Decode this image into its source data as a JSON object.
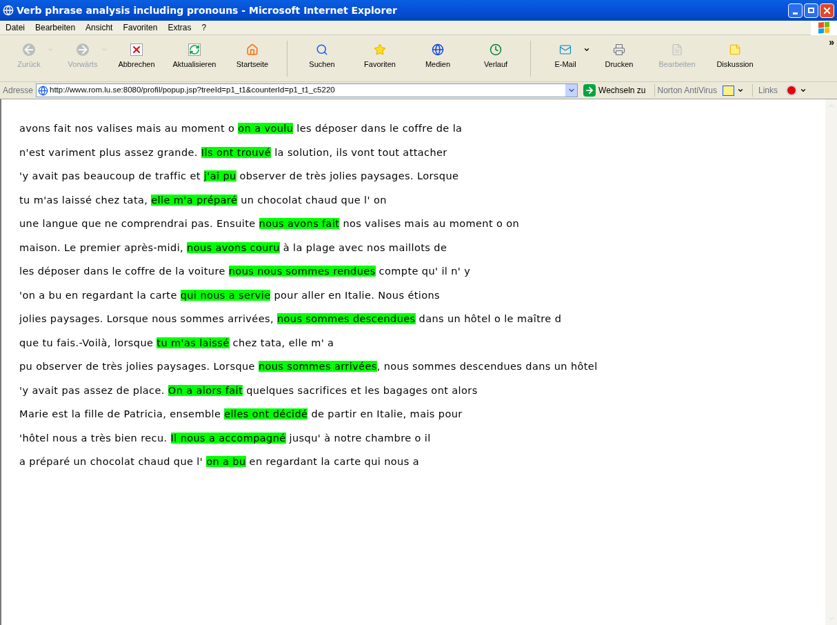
{
  "window": {
    "title": "Verb phrase analysis including pronouns - Microsoft Internet Explorer"
  },
  "menu": [
    "Datei",
    "Bearbeiten",
    "Ansicht",
    "Favoriten",
    "Extras",
    "?"
  ],
  "toolbar": [
    {
      "kind": "back",
      "label": "Zurück",
      "disabled": true,
      "dropdown": true
    },
    {
      "kind": "forward",
      "label": "Vorwärts",
      "disabled": true,
      "dropdown": true
    },
    {
      "kind": "stop",
      "label": "Abbrechen",
      "disabled": false,
      "dropdown": false
    },
    {
      "kind": "refresh",
      "label": "Aktualisieren",
      "disabled": false,
      "dropdown": false
    },
    {
      "kind": "home",
      "label": "Startseite",
      "disabled": false,
      "dropdown": false
    },
    {
      "kind": "separator"
    },
    {
      "kind": "search",
      "label": "Suchen",
      "disabled": false,
      "dropdown": false
    },
    {
      "kind": "favorites",
      "label": "Favoriten",
      "disabled": false,
      "dropdown": false
    },
    {
      "kind": "media",
      "label": "Medien",
      "disabled": false,
      "dropdown": false
    },
    {
      "kind": "history",
      "label": "Verlauf",
      "disabled": false,
      "dropdown": false
    },
    {
      "kind": "separator"
    },
    {
      "kind": "mail",
      "label": "E-Mail",
      "disabled": false,
      "dropdown": true
    },
    {
      "kind": "print",
      "label": "Drucken",
      "disabled": false,
      "dropdown": false
    },
    {
      "kind": "edit",
      "label": "Bearbeiten",
      "disabled": true,
      "dropdown": false
    },
    {
      "kind": "discuss",
      "label": "Diskussion",
      "disabled": false,
      "dropdown": false
    }
  ],
  "overflow": "»",
  "address_bar": {
    "label": "Adresse",
    "url": "http://www.rom.lu.se:8080/profil/popup.jsp?treeId=p1_t1&counterId=p1_t1_c5220",
    "go": "Wechseln zu",
    "norton": "Norton AntiVirus",
    "links": "Links"
  },
  "lines": [
    {
      "before": "avons fait nos valises mais au moment o ",
      "match": "on a voulu",
      "after": " les déposer dans le coffre de la"
    },
    {
      "before": "n'est variment plus assez grande. ",
      "match": "Ils ont trouvé",
      "after": " la solution, ils vont tout attacher"
    },
    {
      "before": "'y avait pas beaucoup de traffic et ",
      "match": "j'ai pu",
      "after": " observer de très jolies paysages. Lorsque"
    },
    {
      "before": "tu m'as laissé chez tata, ",
      "match": "elle m'a préparé",
      "after": " un chocolat chaud que l' on"
    },
    {
      "before": "une langue que ne comprendrai pas. Ensuite ",
      "match": "nous avons fait",
      "after": " nos valises mais au moment o on"
    },
    {
      "before": "maison. Le premier après-midi, ",
      "match": "nous avons couru",
      "after": " à la plage avec nos maillots de"
    },
    {
      "before": "les déposer dans le coffre de la voiture ",
      "match": "nous nous sommes rendues",
      "after": " compte qu' il n' y"
    },
    {
      "before": "'on a bu en regardant la carte ",
      "match": "qui nous a servie",
      "after": " pour aller en Italie. Nous étions"
    },
    {
      "before": "jolies paysages. Lorsque nous sommes arrivées, ",
      "match": "nous sommes descendues",
      "after": " dans un hôtel o le maître d"
    },
    {
      "before": "que tu fais.-Voilà, lorsque ",
      "match": "tu m'as laissé",
      "after": " chez tata, elle m' a"
    },
    {
      "before": "pu observer de très jolies paysages. Lorsque ",
      "match": "nous sommes arrivées",
      "after": ", nous sommes descendues dans un hôtel"
    },
    {
      "before": "'y avait pas assez de place. ",
      "match": "On a alors fait",
      "after": " quelques sacrifices et les bagages ont alors"
    },
    {
      "before": "Marie est la fille de Patricia, ensemble ",
      "match": "elles ont décidé",
      "after": " de partir en Italie, mais pour"
    },
    {
      "before": "'hôtel nous a très bien recu. ",
      "match": "Il nous a accompagné",
      "after": " jusqu' à notre chambre o il"
    },
    {
      "before": "a préparé un chocolat chaud que l' ",
      "match": "on a bu",
      "after": " en regardant la carte qui nous a"
    }
  ]
}
